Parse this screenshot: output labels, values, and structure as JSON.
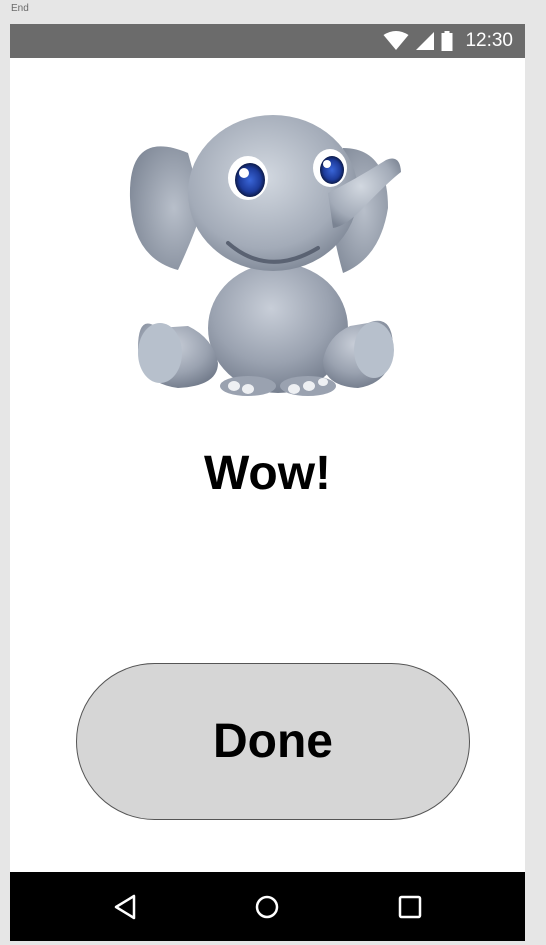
{
  "frame": {
    "label": "End"
  },
  "status_bar": {
    "time": "12:30",
    "icons": [
      "wifi-icon",
      "cell-signal-icon",
      "battery-icon"
    ],
    "background": "#6b6b6b"
  },
  "main": {
    "image": "elephant-illustration",
    "headline": "Wow!",
    "done_button_label": "Done",
    "button_color": "#d6d6d6"
  },
  "nav_bar": {
    "items": [
      "back-icon",
      "home-icon",
      "recents-icon"
    ],
    "background": "#000000"
  }
}
